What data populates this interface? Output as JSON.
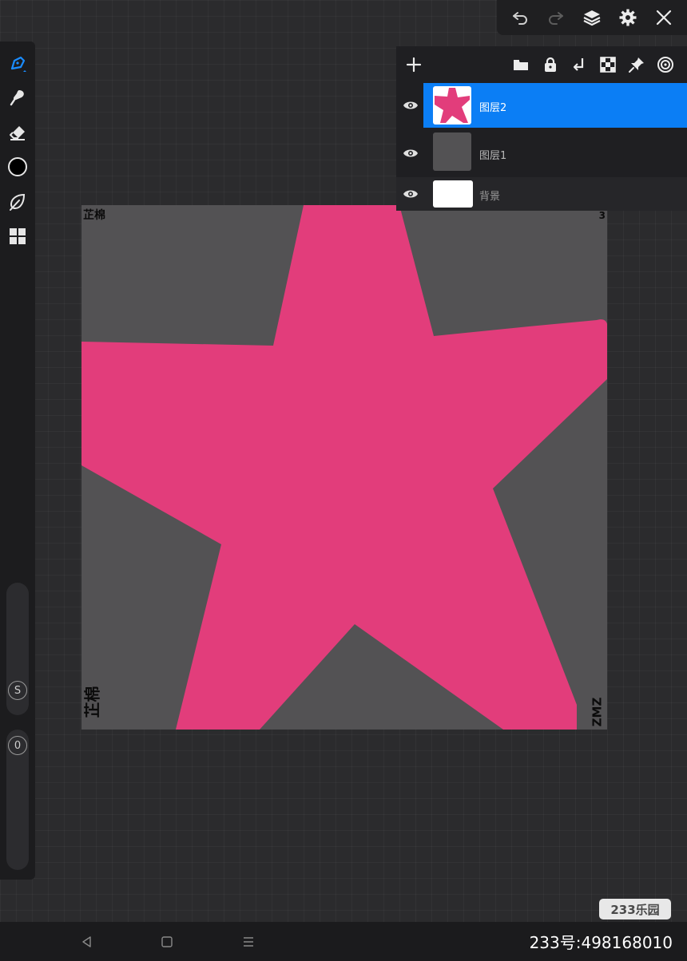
{
  "toolbar": {
    "icons": [
      "undo-icon",
      "redo-icon",
      "layers-icon",
      "settings-icon",
      "close-icon"
    ]
  },
  "left_tools": {
    "icons": [
      "brush-icon",
      "smudge-icon",
      "eraser-icon",
      "color-icon",
      "leaf-icon",
      "gallery-icon"
    ],
    "size_slider_label": "S",
    "opacity_slider_label": "0"
  },
  "layers_panel": {
    "toolbar_icons": [
      "add-layer-icon",
      "folder-icon",
      "lock-icon",
      "merge-down-icon",
      "checker-icon",
      "pin-icon",
      "target-icon"
    ],
    "layers": [
      {
        "name": "图层2",
        "active": true,
        "thumbnail": "pink star"
      },
      {
        "name": "图层1",
        "active": false,
        "thumbnail": "gray"
      },
      {
        "name": "背景",
        "active": false,
        "thumbnail": "white"
      }
    ]
  },
  "canvas": {
    "signature_top_left": "芷棉",
    "signature_bottom_left": "芷棉",
    "signature_bottom_right": "ZMZ",
    "corner_mark_top_right": "3",
    "colors": {
      "background": "#535254",
      "star": "#e23d7b"
    }
  },
  "watermark": "233乐园",
  "bottom_id": "233号:498168010",
  "nav": {
    "icons": [
      "back-icon",
      "home-icon",
      "menu-icon"
    ]
  }
}
